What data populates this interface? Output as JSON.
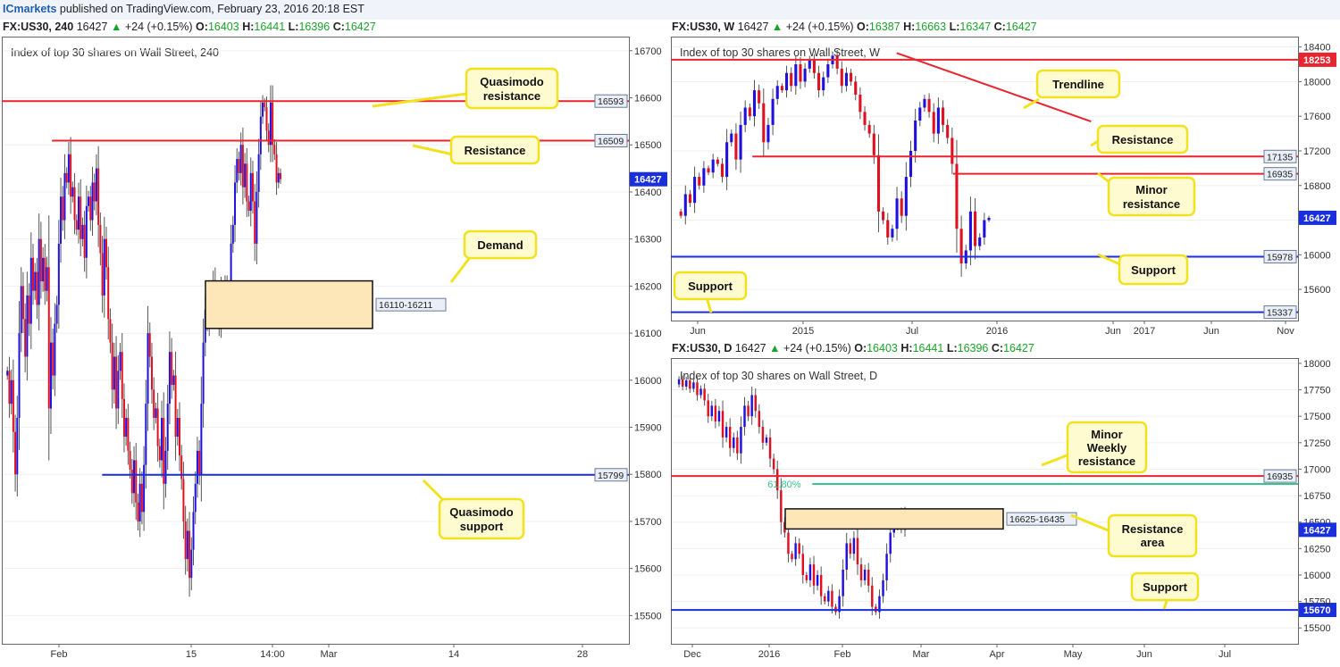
{
  "header": {
    "brand": "ICmarkets",
    "published": " published on TradingView.com, February 23, 2016 20:18 EST"
  },
  "colors": {
    "bull": "#1f10e0",
    "bear": "#e01020",
    "red_line": "#e8252f",
    "blue_line": "#1a2fdc",
    "fib_line": "#38c38c",
    "zone_fill": "#fde6b8",
    "callout_fill": "#fffbd0",
    "callout_stroke": "#f2e21e"
  },
  "chart_data": [
    {
      "id": "h4",
      "type": "candlestick",
      "symbol": "FX:US30, 240",
      "change": "+24 (+0.15%)",
      "ohlc": {
        "O": "16403",
        "H": "16441",
        "L": "16396",
        "C": "16427"
      },
      "last": "16427",
      "title": "Index of top 30 shares on Wall Street, 240",
      "ylim": [
        15440,
        16730
      ],
      "y_ticks": [
        15500,
        15600,
        15700,
        15800,
        15900,
        16000,
        16100,
        16200,
        16300,
        16400,
        16500,
        16600,
        16700
      ],
      "x_ticks": [
        "Feb",
        "15",
        "14:00",
        "Mar",
        "14",
        "28"
      ],
      "levels": [
        {
          "value": 16593,
          "label": "16593",
          "color": "red",
          "from": 0.0
        },
        {
          "value": 16509,
          "label": "16509",
          "color": "red",
          "from": 0.08
        },
        {
          "value": 15799,
          "label": "15799",
          "color": "blue",
          "from": 0.16
        }
      ],
      "zones": [
        {
          "low": 16110,
          "high": 16211,
          "label": "16110-16211"
        }
      ],
      "callouts": [
        {
          "text": [
            "Quasimodo",
            "resistance"
          ]
        },
        {
          "text": [
            "Resistance"
          ]
        },
        {
          "text": [
            "Demand"
          ]
        },
        {
          "text": [
            "Quasimodo",
            "support"
          ]
        }
      ],
      "series": [
        16010,
        16020,
        15950,
        16000,
        15890,
        15800,
        15920,
        16100,
        16200,
        16130,
        16050,
        16180,
        16120,
        16260,
        16190,
        16230,
        16160,
        16300,
        16210,
        16260,
        16190,
        16240,
        15940,
        16080,
        16010,
        16120,
        16160,
        16290,
        16390,
        16340,
        16440,
        16420,
        16480,
        16390,
        16410,
        16340,
        16320,
        16390,
        16300,
        16330,
        16260,
        16370,
        16390,
        16340,
        16420,
        16380,
        16450,
        16330,
        16270,
        16180,
        16300,
        16240,
        16130,
        16080,
        15980,
        16050,
        15940,
        16020,
        16060,
        15960,
        15880,
        15920,
        15850,
        15810,
        15760,
        15830,
        15740,
        15700,
        15780,
        15720,
        15820,
        15950,
        16100,
        16050,
        15980,
        15920,
        15940,
        15860,
        15830,
        15920,
        15780,
        15850,
        15950,
        16060,
        15990,
        16010,
        15880,
        15920,
        15840,
        15790,
        15700,
        15620,
        15680,
        15580,
        15640,
        15720,
        15780,
        15850,
        15800,
        15950,
        16080,
        16150,
        16120,
        16180,
        16160,
        16210,
        16140,
        16180,
        16120,
        16190,
        16200,
        16150,
        16200,
        16190,
        16290,
        16330,
        16420,
        16470,
        16440,
        16500,
        16410,
        16460,
        16380,
        16360,
        16440,
        16380,
        16290,
        16400,
        16480,
        16560,
        16590,
        16580,
        16530,
        16500,
        16590,
        16500,
        16480,
        16420,
        16440,
        16427
      ]
    },
    {
      "id": "weekly",
      "type": "candlestick",
      "symbol": "FX:US30, W",
      "change": "+24 (+0.15%)",
      "ohlc": {
        "O": "16387",
        "H": "16663",
        "L": "16347",
        "C": "16427"
      },
      "last": "16427",
      "title": "Index of top 30 shares on Wall Street, W",
      "ylim": [
        15240,
        18520
      ],
      "y_ticks": [
        15600,
        16000,
        16400,
        16800,
        17200,
        17600,
        18000,
        18400
      ],
      "x_ticks": [
        "Jun",
        "2015",
        "Jul",
        "2016",
        "Jun",
        "2017",
        "Jun",
        "Nov"
      ],
      "levels": [
        {
          "value": 18253,
          "label": "18253",
          "color": "red",
          "from": 0.0,
          "filled": true
        },
        {
          "value": 17135,
          "label": "17135",
          "color": "red",
          "from": 0.13
        },
        {
          "value": 16935,
          "label": "16935",
          "color": "red",
          "from": 0.45
        },
        {
          "value": 15978,
          "label": "15978",
          "color": "blue",
          "from": 0.0
        },
        {
          "value": 15337,
          "label": "15337",
          "color": "blue",
          "from": 0.0
        }
      ],
      "trendline": {
        "from": [
          0.36,
          18330
        ],
        "to": [
          0.67,
          17540
        ]
      },
      "callouts": [
        {
          "text": [
            "Trendline"
          ]
        },
        {
          "text": [
            "Resistance"
          ]
        },
        {
          "text": [
            "Minor",
            "resistance"
          ]
        },
        {
          "text": [
            "Support"
          ]
        },
        {
          "text": [
            "Support"
          ]
        }
      ],
      "series": [
        16500,
        16450,
        16700,
        16600,
        16900,
        16800,
        17000,
        16950,
        17100,
        17050,
        16900,
        17300,
        17400,
        17100,
        17500,
        17700,
        17600,
        17900,
        17750,
        17300,
        17500,
        17800,
        17950,
        17900,
        18100,
        17950,
        18200,
        18000,
        18150,
        18250,
        18100,
        17900,
        18050,
        18200,
        18300,
        18150,
        17950,
        18100,
        18000,
        17850,
        17650,
        17500,
        17400,
        17150,
        16500,
        16400,
        16200,
        16300,
        16650,
        16450,
        16900,
        17200,
        17550,
        17700,
        17800,
        17650,
        17400,
        17700,
        17500,
        17350,
        17050,
        16300,
        15900,
        16050,
        16500,
        16100,
        16200,
        16400,
        16427
      ]
    },
    {
      "id": "daily",
      "type": "candlestick",
      "symbol": "FX:US30, D",
      "change": "+24 (+0.15%)",
      "ohlc": {
        "O": "16403",
        "H": "16441",
        "L": "16396",
        "C": "16427"
      },
      "last": "16427",
      "title": "Index of top 30 shares on Wall Street, D",
      "ylim": [
        15350,
        18050
      ],
      "y_ticks": [
        15500,
        15750,
        16000,
        16250,
        16500,
        16750,
        17000,
        17250,
        17500,
        17750,
        18000
      ],
      "x_ticks": [
        "Dec",
        "2016",
        "Feb",
        "Mar",
        "Apr",
        "May",
        "Jun",
        "Jul"
      ],
      "levels": [
        {
          "value": 16935,
          "label": "16935",
          "color": "red",
          "from": 0.0
        },
        {
          "value": 16860,
          "label": "61.80%",
          "color": "fib",
          "from": 0.14
        },
        {
          "value": 15670,
          "label": "15670",
          "color": "blue",
          "from": 0.0,
          "filled": true
        }
      ],
      "zones": [
        {
          "low": 16435,
          "high": 16625,
          "label": "16625-16435"
        }
      ],
      "callouts": [
        {
          "text": [
            "Minor",
            "Weekly",
            "resistance"
          ]
        },
        {
          "text": [
            "Resistance",
            "area"
          ]
        },
        {
          "text": [
            "Support"
          ]
        }
      ],
      "series": [
        17800,
        17850,
        17780,
        17840,
        17760,
        17820,
        17700,
        17760,
        17650,
        17500,
        17600,
        17450,
        17550,
        17300,
        17400,
        17200,
        17300,
        17150,
        17400,
        17600,
        17500,
        17700,
        17550,
        17400,
        17250,
        17300,
        17100,
        17000,
        16800,
        16500,
        16400,
        16200,
        16150,
        16300,
        16200,
        16000,
        15950,
        16100,
        15900,
        16000,
        15800,
        15750,
        15850,
        15700,
        15650,
        15800,
        16050,
        16300,
        16200,
        16350,
        16100,
        15950,
        16050,
        15900,
        15700,
        15650,
        15800,
        15950,
        16200,
        16400,
        16500,
        16450,
        16580,
        16427
      ]
    }
  ]
}
